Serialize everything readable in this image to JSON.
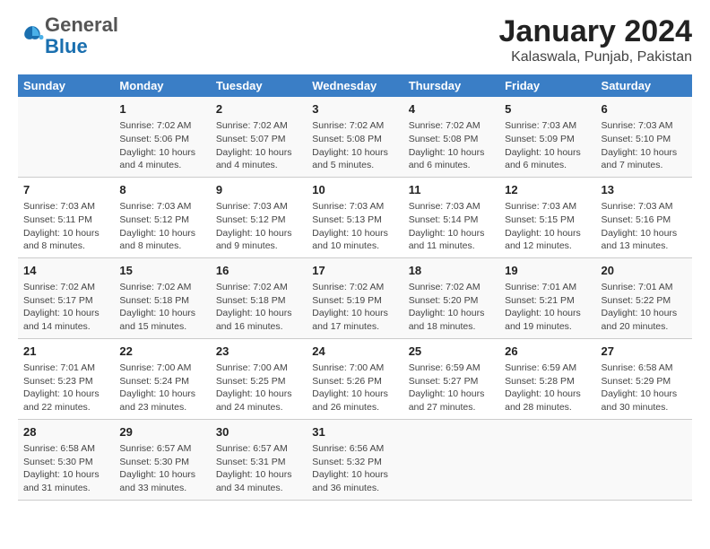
{
  "header": {
    "logo_general": "General",
    "logo_blue": "Blue",
    "title": "January 2024",
    "subtitle": "Kalaswala, Punjab, Pakistan"
  },
  "days_of_week": [
    "Sunday",
    "Monday",
    "Tuesday",
    "Wednesday",
    "Thursday",
    "Friday",
    "Saturday"
  ],
  "weeks": [
    [
      {
        "day": "",
        "info": ""
      },
      {
        "day": "1",
        "info": "Sunrise: 7:02 AM\nSunset: 5:06 PM\nDaylight: 10 hours\nand 4 minutes."
      },
      {
        "day": "2",
        "info": "Sunrise: 7:02 AM\nSunset: 5:07 PM\nDaylight: 10 hours\nand 4 minutes."
      },
      {
        "day": "3",
        "info": "Sunrise: 7:02 AM\nSunset: 5:08 PM\nDaylight: 10 hours\nand 5 minutes."
      },
      {
        "day": "4",
        "info": "Sunrise: 7:02 AM\nSunset: 5:08 PM\nDaylight: 10 hours\nand 6 minutes."
      },
      {
        "day": "5",
        "info": "Sunrise: 7:03 AM\nSunset: 5:09 PM\nDaylight: 10 hours\nand 6 minutes."
      },
      {
        "day": "6",
        "info": "Sunrise: 7:03 AM\nSunset: 5:10 PM\nDaylight: 10 hours\nand 7 minutes."
      }
    ],
    [
      {
        "day": "7",
        "info": "Sunrise: 7:03 AM\nSunset: 5:11 PM\nDaylight: 10 hours\nand 8 minutes."
      },
      {
        "day": "8",
        "info": "Sunrise: 7:03 AM\nSunset: 5:12 PM\nDaylight: 10 hours\nand 8 minutes."
      },
      {
        "day": "9",
        "info": "Sunrise: 7:03 AM\nSunset: 5:12 PM\nDaylight: 10 hours\nand 9 minutes."
      },
      {
        "day": "10",
        "info": "Sunrise: 7:03 AM\nSunset: 5:13 PM\nDaylight: 10 hours\nand 10 minutes."
      },
      {
        "day": "11",
        "info": "Sunrise: 7:03 AM\nSunset: 5:14 PM\nDaylight: 10 hours\nand 11 minutes."
      },
      {
        "day": "12",
        "info": "Sunrise: 7:03 AM\nSunset: 5:15 PM\nDaylight: 10 hours\nand 12 minutes."
      },
      {
        "day": "13",
        "info": "Sunrise: 7:03 AM\nSunset: 5:16 PM\nDaylight: 10 hours\nand 13 minutes."
      }
    ],
    [
      {
        "day": "14",
        "info": "Sunrise: 7:02 AM\nSunset: 5:17 PM\nDaylight: 10 hours\nand 14 minutes."
      },
      {
        "day": "15",
        "info": "Sunrise: 7:02 AM\nSunset: 5:18 PM\nDaylight: 10 hours\nand 15 minutes."
      },
      {
        "day": "16",
        "info": "Sunrise: 7:02 AM\nSunset: 5:18 PM\nDaylight: 10 hours\nand 16 minutes."
      },
      {
        "day": "17",
        "info": "Sunrise: 7:02 AM\nSunset: 5:19 PM\nDaylight: 10 hours\nand 17 minutes."
      },
      {
        "day": "18",
        "info": "Sunrise: 7:02 AM\nSunset: 5:20 PM\nDaylight: 10 hours\nand 18 minutes."
      },
      {
        "day": "19",
        "info": "Sunrise: 7:01 AM\nSunset: 5:21 PM\nDaylight: 10 hours\nand 19 minutes."
      },
      {
        "day": "20",
        "info": "Sunrise: 7:01 AM\nSunset: 5:22 PM\nDaylight: 10 hours\nand 20 minutes."
      }
    ],
    [
      {
        "day": "21",
        "info": "Sunrise: 7:01 AM\nSunset: 5:23 PM\nDaylight: 10 hours\nand 22 minutes."
      },
      {
        "day": "22",
        "info": "Sunrise: 7:00 AM\nSunset: 5:24 PM\nDaylight: 10 hours\nand 23 minutes."
      },
      {
        "day": "23",
        "info": "Sunrise: 7:00 AM\nSunset: 5:25 PM\nDaylight: 10 hours\nand 24 minutes."
      },
      {
        "day": "24",
        "info": "Sunrise: 7:00 AM\nSunset: 5:26 PM\nDaylight: 10 hours\nand 26 minutes."
      },
      {
        "day": "25",
        "info": "Sunrise: 6:59 AM\nSunset: 5:27 PM\nDaylight: 10 hours\nand 27 minutes."
      },
      {
        "day": "26",
        "info": "Sunrise: 6:59 AM\nSunset: 5:28 PM\nDaylight: 10 hours\nand 28 minutes."
      },
      {
        "day": "27",
        "info": "Sunrise: 6:58 AM\nSunset: 5:29 PM\nDaylight: 10 hours\nand 30 minutes."
      }
    ],
    [
      {
        "day": "28",
        "info": "Sunrise: 6:58 AM\nSunset: 5:30 PM\nDaylight: 10 hours\nand 31 minutes."
      },
      {
        "day": "29",
        "info": "Sunrise: 6:57 AM\nSunset: 5:30 PM\nDaylight: 10 hours\nand 33 minutes."
      },
      {
        "day": "30",
        "info": "Sunrise: 6:57 AM\nSunset: 5:31 PM\nDaylight: 10 hours\nand 34 minutes."
      },
      {
        "day": "31",
        "info": "Sunrise: 6:56 AM\nSunset: 5:32 PM\nDaylight: 10 hours\nand 36 minutes."
      },
      {
        "day": "",
        "info": ""
      },
      {
        "day": "",
        "info": ""
      },
      {
        "day": "",
        "info": ""
      }
    ]
  ]
}
